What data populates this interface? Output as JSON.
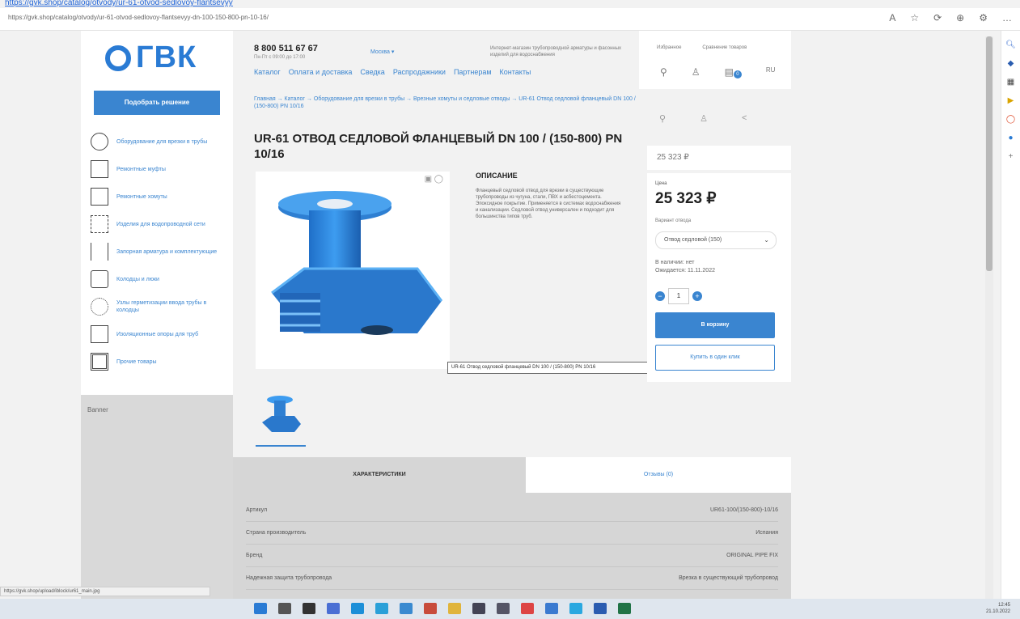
{
  "browser": {
    "top_link": "https://gvk.shop/catalog/otvody/ur-61-otvod-sedlovoy-flantsevyy",
    "url": "https://gvk.shop/catalog/otvody/ur-61-otvod-sedlovoy-flantsevyy-dn-100-150-800-pn-10-16/",
    "toolbar_icons": [
      "A",
      "☆",
      "⟳",
      "⊕",
      "⚙",
      "…"
    ],
    "right_rail_icons": [
      "search-icon",
      "tag-icon",
      "office-icon",
      "play-icon",
      "circle-icon",
      "bird-icon",
      "plus-icon"
    ]
  },
  "header": {
    "logo_text": "ГВК",
    "phone": "8 800 511 67 67",
    "phone_sub": "Пн-Пт с 09:00 до 17:00",
    "city": "Москва ▾",
    "note": "Интернет-магазин трубопроводной арматуры и фасонных изделий для водоснабжения",
    "nav": [
      "Каталог",
      "Оплата и доставка",
      "Сведка",
      "Распродажники",
      "Партнерам",
      "Контакты"
    ]
  },
  "user": {
    "links": [
      "Избранное",
      "Сравнение товаров"
    ],
    "cart_count": "0",
    "lang": "RU"
  },
  "sidebar": {
    "pick_button": "Подобрать решение",
    "categories": [
      "Оборудование для врезки в трубы",
      "Ремонтные муфты",
      "Ремонтные хомуты",
      "Изделия для водопроводной сети",
      "Запорная арматура и комплектующие",
      "Колодцы и люки",
      "Узлы герметизации ввода трубы в колодцы",
      "Изоляционные опоры для труб",
      "Прочие товары"
    ],
    "image_alt": "Banner"
  },
  "product": {
    "breadcrumb": "Главная → Каталог → Оборудование для врезки в трубы → Врезные хомуты и седловые отводы → UR-61 Отвод седловой фланцевый DN 100 / (150-800) PN 10/16",
    "title": "UR-61 ОТВОД СЕДЛОВОЙ ФЛАНЦЕВЫЙ DN 100 / (150-800) PN 10/16",
    "description_heading": "ОПИСАНИЕ",
    "description_text": "Фланцевый седловой отвод для врезки в существующие трубопроводы из чугуна, стали, ПВХ и асбестоцемента. Эпоксидное покрытие. Применяется в системах водоснабжения и канализации. Седловой отвод универсален и подходит для большинства типов труб.",
    "tooltip": "UR-61 Отвод седловой фланцевый DN 100 / (150-800) PN 10/16"
  },
  "pricing": {
    "small_price": "25 323 ₽",
    "price_label": "Цена",
    "price": "25 323 ₽",
    "select_label": "Вариант отвода",
    "select_value": "Отвод седловой (150)",
    "stock_line1": "В наличии: нет",
    "stock_line2": "Ожидается: 11.11.2022",
    "qty": "1",
    "cart_button": "В корзину",
    "one_click_button": "Купить в один клик"
  },
  "tabs": {
    "active": "ХАРАКТЕРИСТИКИ",
    "other": "Отзывы (0)"
  },
  "specs": [
    {
      "label": "Артикул",
      "value": "UR61-100/(150-800)-10/16"
    },
    {
      "label": "Страна производитель",
      "value": "Испания"
    },
    {
      "label": "Бренд",
      "value": "ORIGINAL PIPE FIX"
    },
    {
      "label": "Надежная защита трубопровода",
      "value": "Врезка в существующий трубопровод"
    }
  ],
  "status": {
    "statusbar": "https://gvk.shop/upload/iblock/ur61_main.jpg",
    "clock": "12:45",
    "date": "21.10.2022"
  },
  "colors": {
    "accent": "#3a85d0",
    "product_blue": "#2e7fd2"
  }
}
